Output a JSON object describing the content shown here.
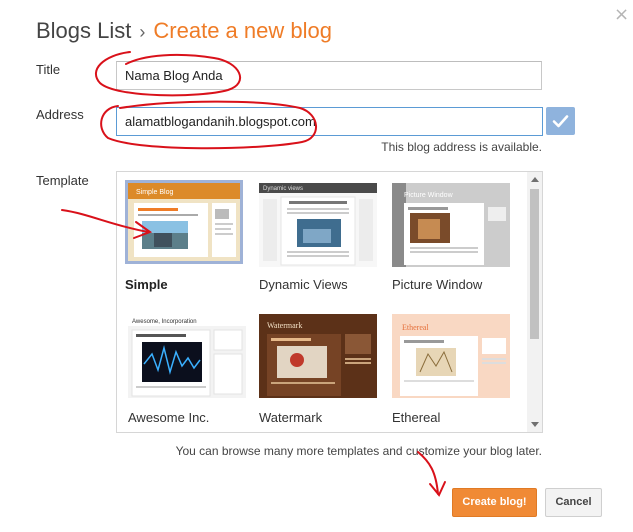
{
  "dialog": {
    "close_glyph": "×"
  },
  "breadcrumb": {
    "parent": "Blogs List",
    "separator": "›",
    "current": "Create a new blog"
  },
  "form": {
    "title_label": "Title",
    "title_value": "Nama Blog Anda",
    "address_label": "Address",
    "address_value": "alamatblogandanih.blogspot.com",
    "address_status": "This blog address is available.",
    "template_label": "Template"
  },
  "templates": [
    {
      "name": "Simple",
      "selected": true
    },
    {
      "name": "Dynamic Views",
      "selected": false
    },
    {
      "name": "Picture Window",
      "selected": false
    },
    {
      "name": "Awesome Inc.",
      "selected": false
    },
    {
      "name": "Watermark",
      "selected": false
    },
    {
      "name": "Ethereal",
      "selected": false
    }
  ],
  "thumb_text": {
    "simple": "Simple Blog",
    "dynamic": "Dynamic views",
    "picture": "Picture Window",
    "awesome": "Awesome, Incorporation",
    "watermark": "Watermark",
    "ethereal": "Ethereal"
  },
  "browse_note": "You can browse many more templates and customize your blog later.",
  "buttons": {
    "create": "Create blog!",
    "cancel": "Cancel"
  },
  "colors": {
    "accent": "#ef7c27",
    "primary_button": "#f08a35",
    "annotation": "#d9111a",
    "focus_border": "#5b9bd5"
  },
  "icons": [
    "close-icon",
    "check-icon",
    "scroll-up-icon",
    "scroll-down-icon"
  ]
}
